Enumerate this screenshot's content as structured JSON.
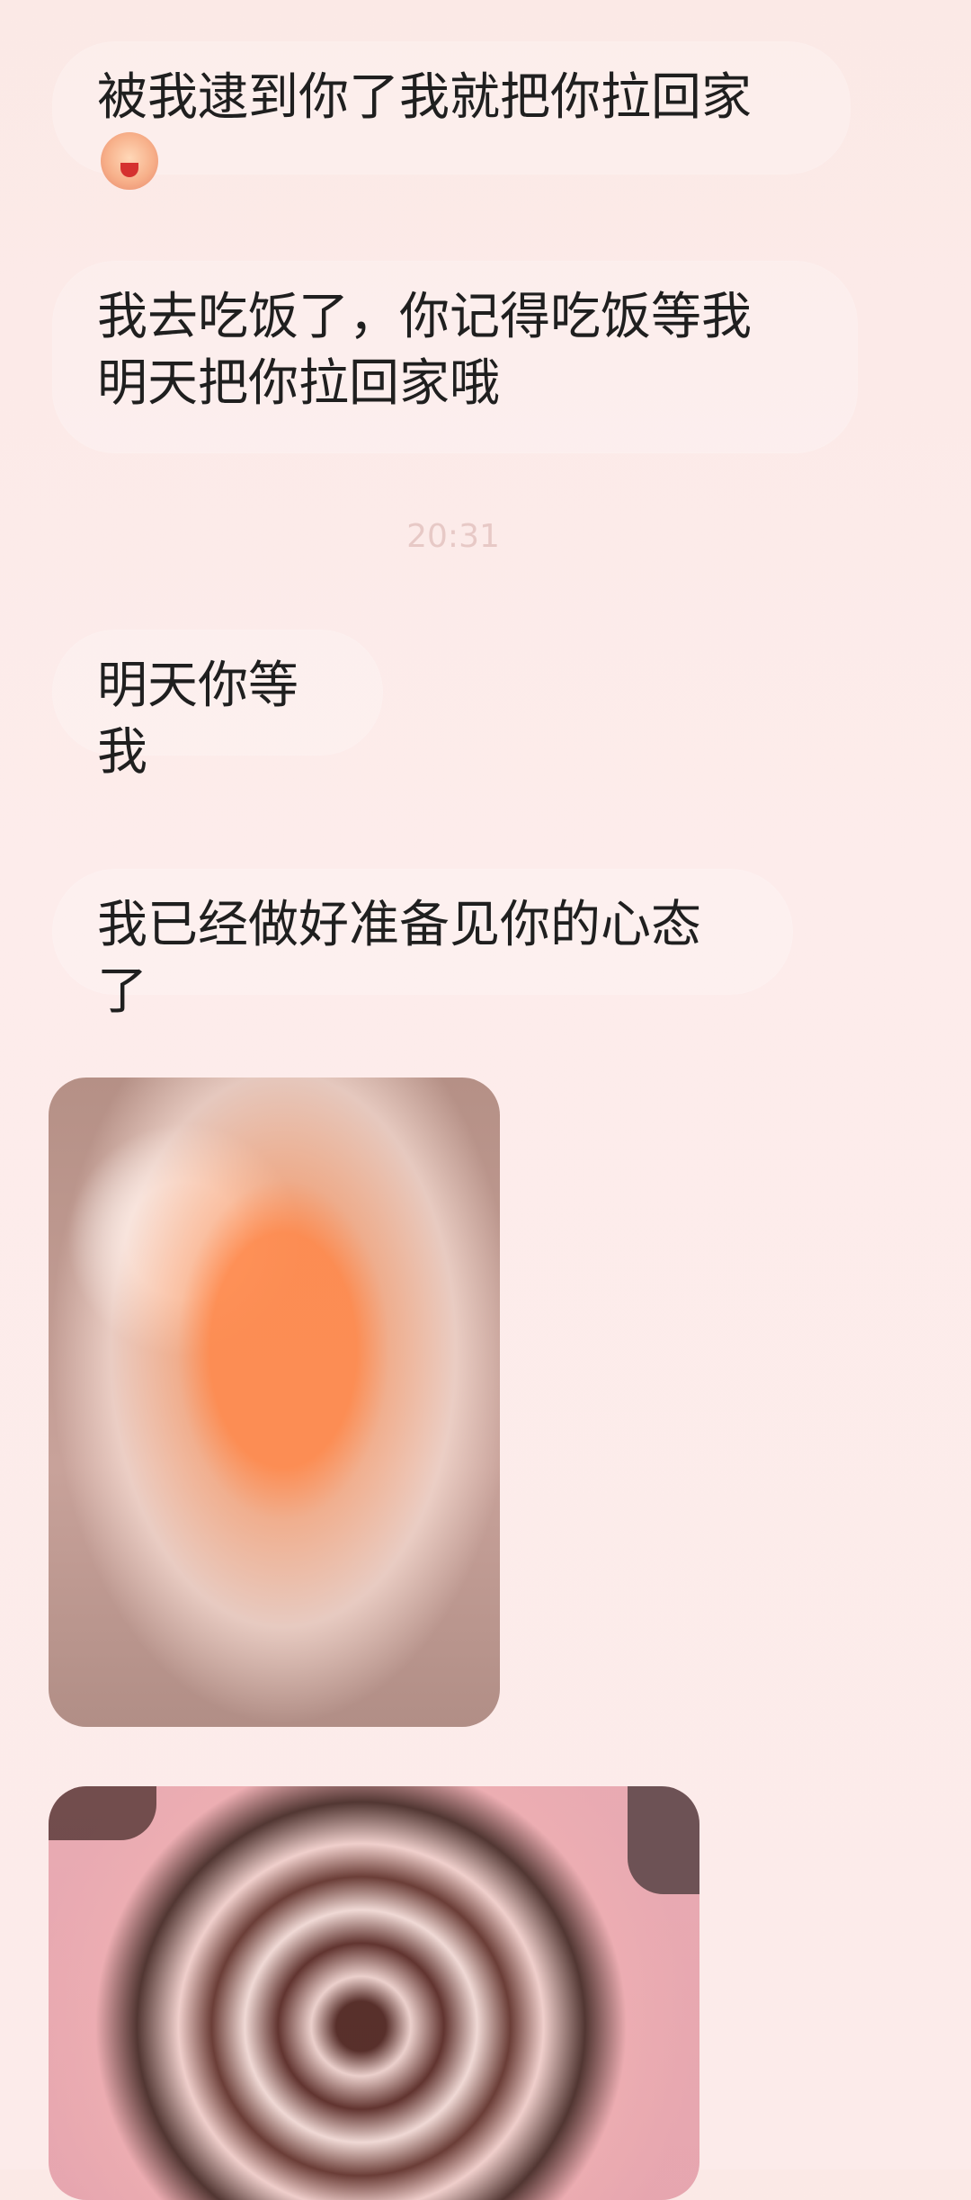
{
  "messages": [
    {
      "text": "被我逮到你了我就把你拉回家",
      "emoji": "see-no-evil-emoji"
    },
    {
      "text": "我去吃饭了，你记得吃饭等我明天把你拉回家哦"
    },
    {
      "text": "明天你等我"
    },
    {
      "text": "我已经做好准备见你的心态了"
    }
  ],
  "timestamp": "20:31",
  "images": [
    {
      "icon": "bouquet-with-crown-photo"
    },
    {
      "icon": "money-bouquet-photo"
    }
  ]
}
